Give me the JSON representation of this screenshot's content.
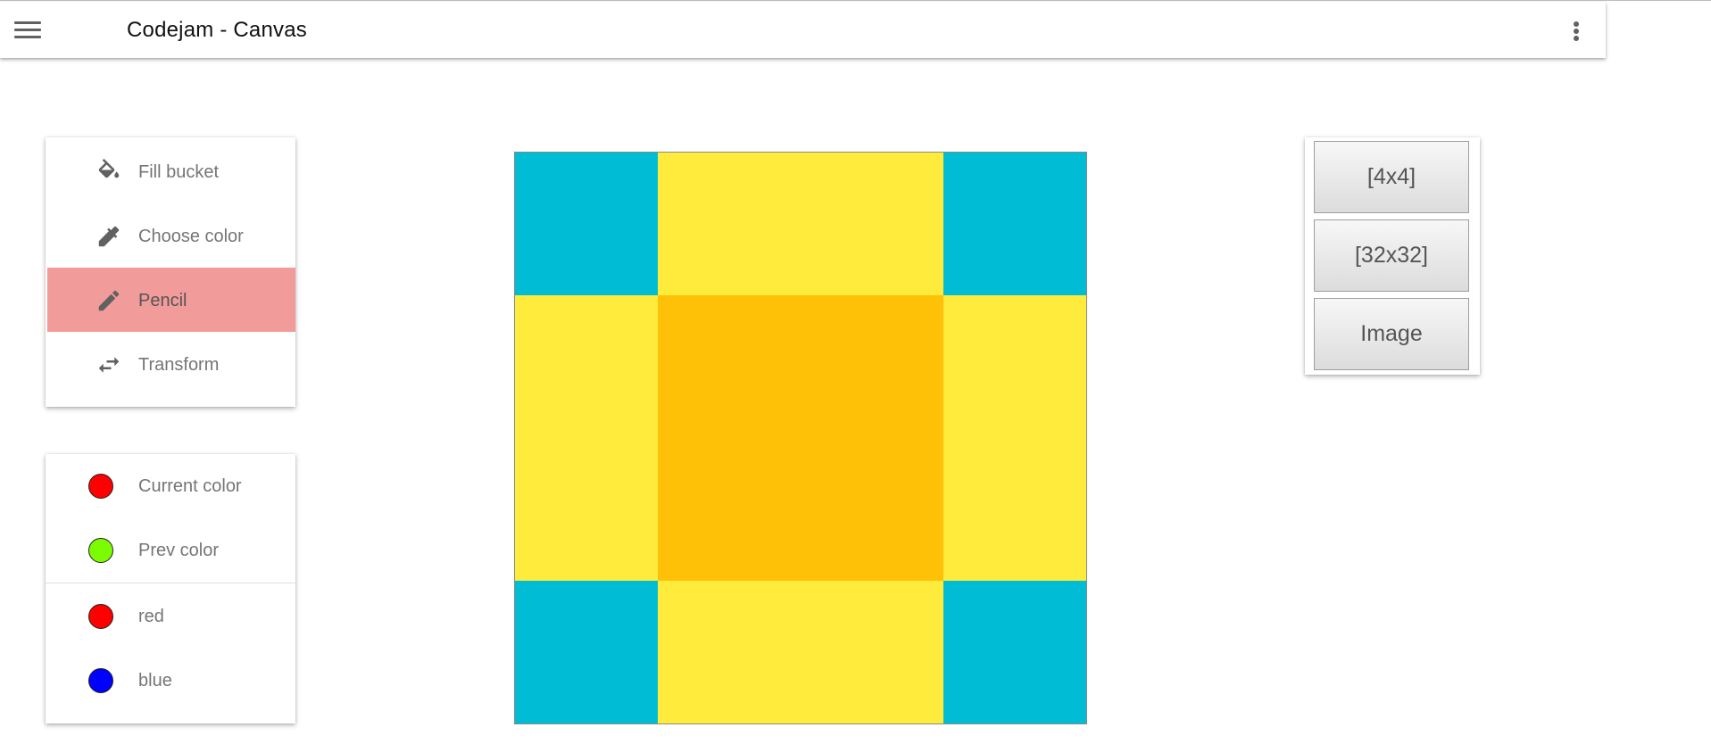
{
  "app": {
    "title": "Codejam - Canvas"
  },
  "appbar": {
    "menu_icon": "hamburger-menu-icon",
    "more_icon": "more-vert-icon"
  },
  "tools": [
    {
      "label": "Fill bucket",
      "icon": "fill-bucket-icon",
      "active": false
    },
    {
      "label": "Choose color",
      "icon": "eyedropper-icon",
      "active": false
    },
    {
      "label": "Pencil",
      "icon": "pencil-icon",
      "active": true
    },
    {
      "label": "Transform",
      "icon": "swap-arrows-icon",
      "active": false
    }
  ],
  "colors": {
    "current": {
      "label": "Current color",
      "color": "#ff0000"
    },
    "prev": {
      "label": "Prev color",
      "color": "#7cfc00"
    },
    "presets": [
      {
        "label": "red",
        "color": "#ff0000"
      },
      {
        "label": "blue",
        "color": "#0000ff"
      }
    ]
  },
  "canvas": {
    "grid": [
      [
        "#00bcd4",
        "#ffeb3b",
        "#00bcd4"
      ],
      [
        "#ffeb3b",
        "#ffc107",
        "#ffeb3b"
      ],
      [
        "#00bcd4",
        "#ffeb3b",
        "#00bcd4"
      ]
    ]
  },
  "size_buttons": [
    "[4x4]",
    "[32x32]",
    "Image"
  ],
  "theme": {
    "active_tool_bg": "#f29b9b",
    "cyan": "#00bcd4",
    "yellow": "#ffeb3b",
    "amber": "#ffc107"
  }
}
